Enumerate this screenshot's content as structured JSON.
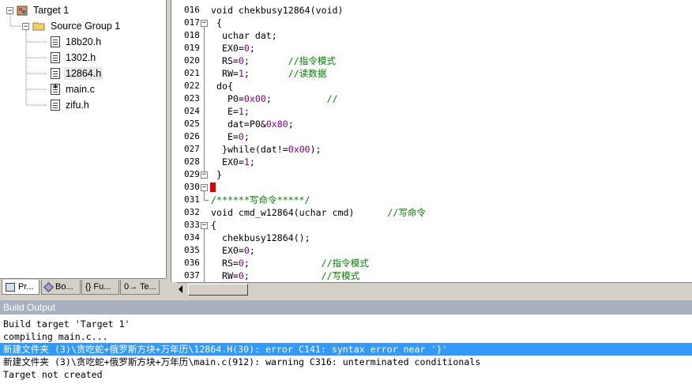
{
  "project": {
    "target": "Target 1",
    "group": "Source Group 1",
    "files": [
      "18b20.h",
      "1302.h",
      "12864.h",
      "main.c",
      "zifu.h"
    ],
    "selected_file": "12864.h"
  },
  "project_tabs": [
    "Pr...",
    "Bo...",
    "{} Fu...",
    "0→ Te..."
  ],
  "editor": {
    "lines": [
      {
        "n": "016",
        "code": "void chekbusy12864(void)"
      },
      {
        "n": "017",
        "code": " {"
      },
      {
        "n": "018",
        "code": "  uchar dat;"
      },
      {
        "n": "019",
        "code": "  EX0=0;"
      },
      {
        "n": "020",
        "code": "  RS=0;       ",
        "comment": "//指令模式"
      },
      {
        "n": "021",
        "code": "  RW=1;       ",
        "comment": "//读数据"
      },
      {
        "n": "022",
        "code": " do{"
      },
      {
        "n": "023",
        "code": "   P0=0x00;          ",
        "comment": "//"
      },
      {
        "n": "024",
        "code": "   E=1;"
      },
      {
        "n": "025",
        "code": "   dat=P0&0x80;"
      },
      {
        "n": "026",
        "code": "   E=0;"
      },
      {
        "n": "027",
        "code": "  }while(dat!=0x00);"
      },
      {
        "n": "028",
        "code": "  EX0=1;"
      },
      {
        "n": "029",
        "code": " }"
      },
      {
        "n": "030",
        "code": ""
      },
      {
        "n": "031",
        "code": "",
        "comment": "/******写命令*****/"
      },
      {
        "n": "032",
        "code": "void cmd_w12864(uchar cmd)      ",
        "comment": "//写命令"
      },
      {
        "n": "033",
        "code": "{"
      },
      {
        "n": "034",
        "code": "  chekbusy12864();"
      },
      {
        "n": "035",
        "code": "  EX0=0;"
      },
      {
        "n": "036",
        "code": "  RS=0;             ",
        "comment": "//指令模式"
      },
      {
        "n": "037",
        "code": "  RW=0;             ",
        "comment": "//写模式"
      }
    ]
  },
  "build_output": {
    "title": "Build Output",
    "lines": [
      "Build target 'Target 1'",
      "compiling main.c...",
      "新建文件夹 (3)\\贪吃蛇+俄罗斯方块+万年历\\12864.H(30): error C141: syntax error near '}'",
      "新建文件夹 (3)\\贪吃蛇+俄罗斯方块+万年历\\main.c(912): warning C316: unterminated conditionals",
      "Target not created"
    ],
    "highlighted_index": 2
  },
  "colors": {
    "comment": "#008000",
    "number": "#800080",
    "highlight": "#3399ff",
    "panel_title": "#a6b0bf",
    "breakpoint": "#e00000"
  }
}
